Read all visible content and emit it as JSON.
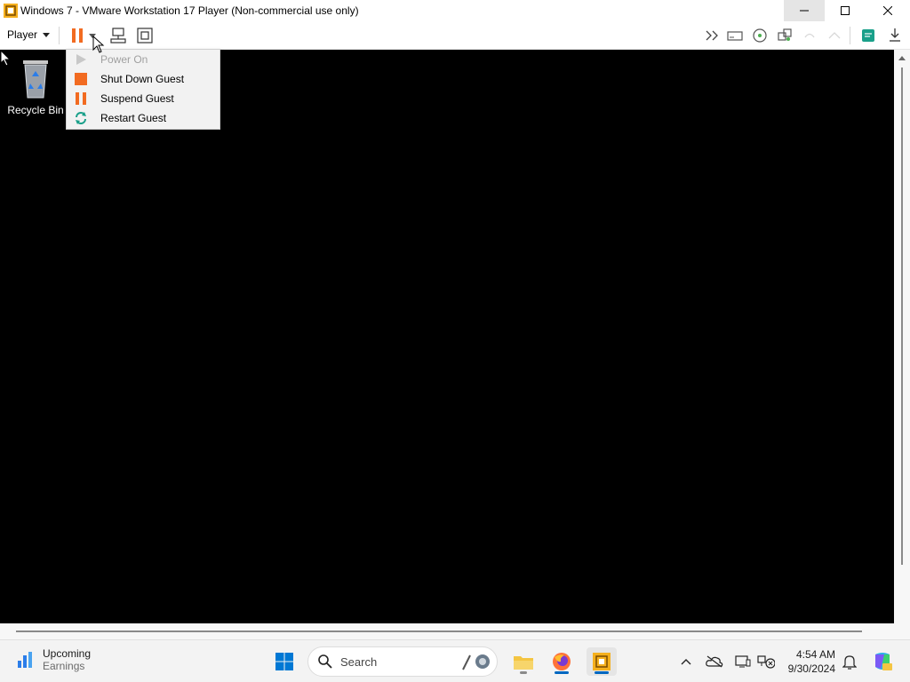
{
  "window": {
    "title": "Windows 7 - VMware Workstation 17 Player (Non-commercial use only)",
    "controls": [
      "minimize",
      "maximize",
      "close"
    ]
  },
  "toolbar": {
    "player_menu_label": "Player",
    "right_icons": [
      "send-ctrl-alt-del-icon",
      "removable-devices-icon",
      "cd-dvd-icon",
      "network-icon",
      "snapshot-icon",
      "unity-icon",
      "message-log-icon",
      "download-icon"
    ]
  },
  "power_menu": {
    "items": [
      {
        "label": "Power On",
        "enabled": false,
        "icon": "play-icon"
      },
      {
        "label": "Shut Down Guest",
        "enabled": true,
        "icon": "stop-icon"
      },
      {
        "label": "Suspend Guest",
        "enabled": true,
        "icon": "pause-icon"
      },
      {
        "label": "Restart Guest",
        "enabled": true,
        "icon": "restart-icon"
      }
    ]
  },
  "guest_desktop": {
    "background": "#000000",
    "icons": [
      {
        "label": "Recycle Bin"
      }
    ]
  },
  "taskbar": {
    "widget": {
      "title": "Upcoming",
      "subtitle": "Earnings"
    },
    "search_placeholder": "Search",
    "apps": [
      "start-icon",
      "file-explorer-icon",
      "firefox-icon",
      "vmware-icon"
    ],
    "clock": {
      "time": "4:54 AM",
      "date": "9/30/2024"
    }
  },
  "colors": {
    "accent_orange": "#f26b21",
    "restart_teal": "#1aa08a",
    "taskbar_indicator": "#0067c0"
  }
}
